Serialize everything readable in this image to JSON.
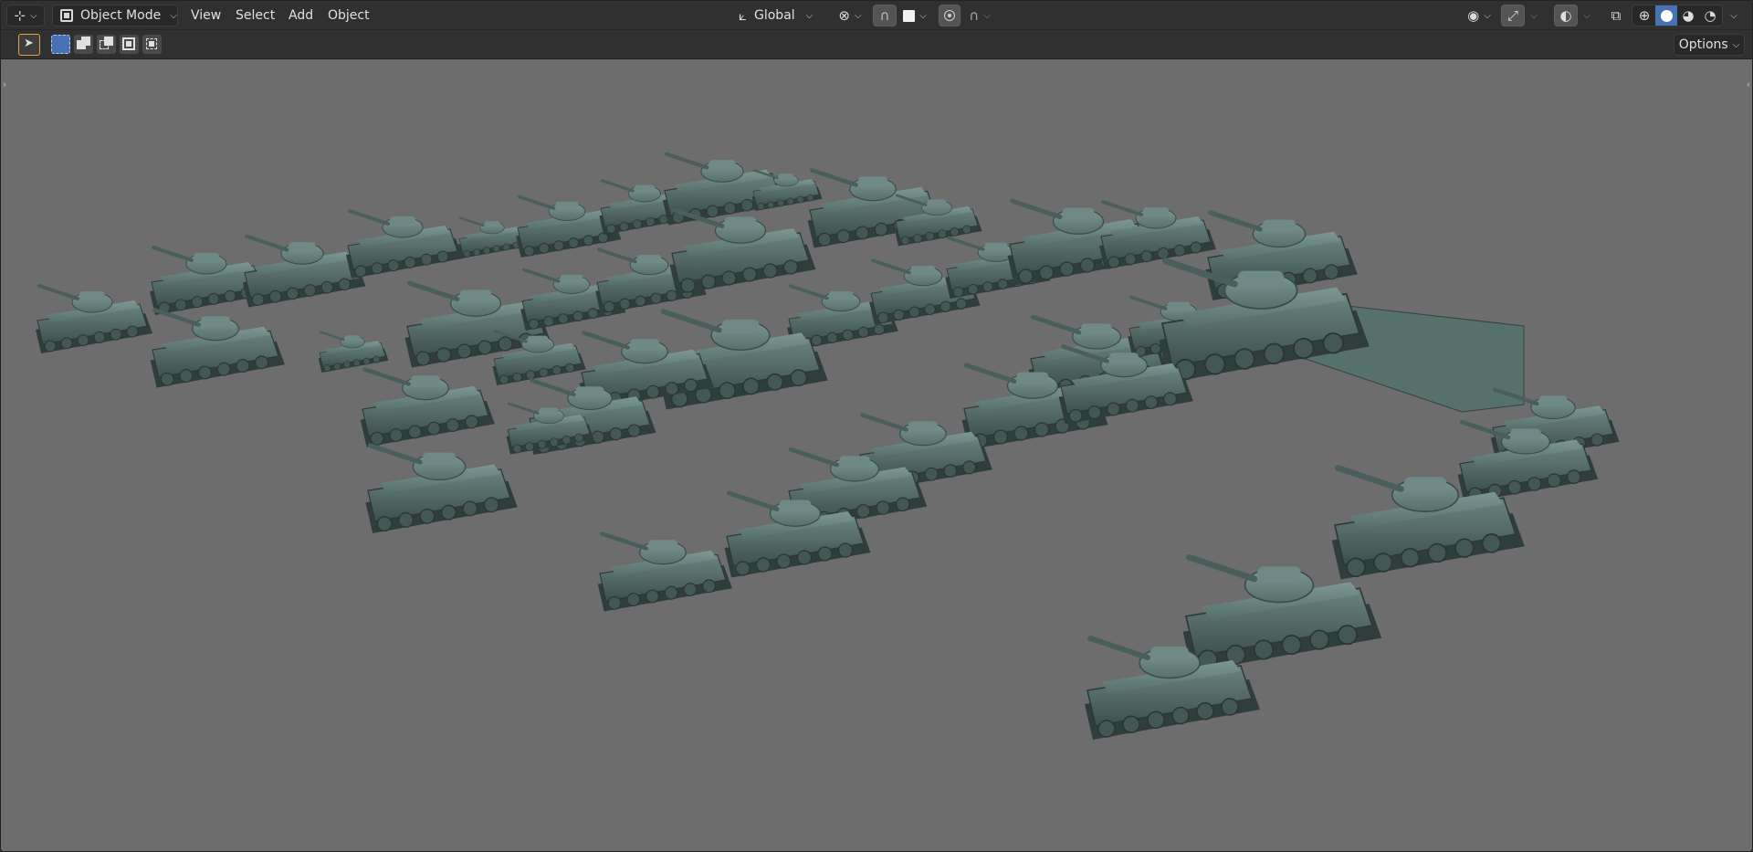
{
  "header": {
    "editor_type_icon": "viewport-3d-icon",
    "mode_icon": "object-mode-icon",
    "mode_label": "Object Mode",
    "menus": [
      "View",
      "Select",
      "Add",
      "Object"
    ],
    "orientation_icon": "transform-orientation-icon",
    "orientation_label": "Global",
    "pivot_icon": "pivot-point-icon",
    "snap_icon": "snap-magnet-icon",
    "snap_target_icon": "snap-target-icon",
    "proportional_icon": "proportional-edit-icon",
    "falloff_icon": "falloff-curve-icon",
    "visibility_icon": "eye-icon",
    "gizmo_icon": "gizmo-icon",
    "overlay_icon": "overlay-icon",
    "xray_icon": "xray-icon",
    "shading_modes": [
      "wireframe",
      "solid",
      "material-preview",
      "rendered"
    ],
    "active_shading": "solid"
  },
  "tool_header": {
    "active_tool_icon": "select-box-icon",
    "selection_modes": [
      "set",
      "extend",
      "subtract",
      "intersect",
      "difference"
    ],
    "options_label": "Options"
  },
  "viewport": {
    "background_color": "#6d6d6d",
    "model_color": "#4e6462",
    "content": "Collection of green-grey solid-shaded tank models arranged in rows"
  }
}
